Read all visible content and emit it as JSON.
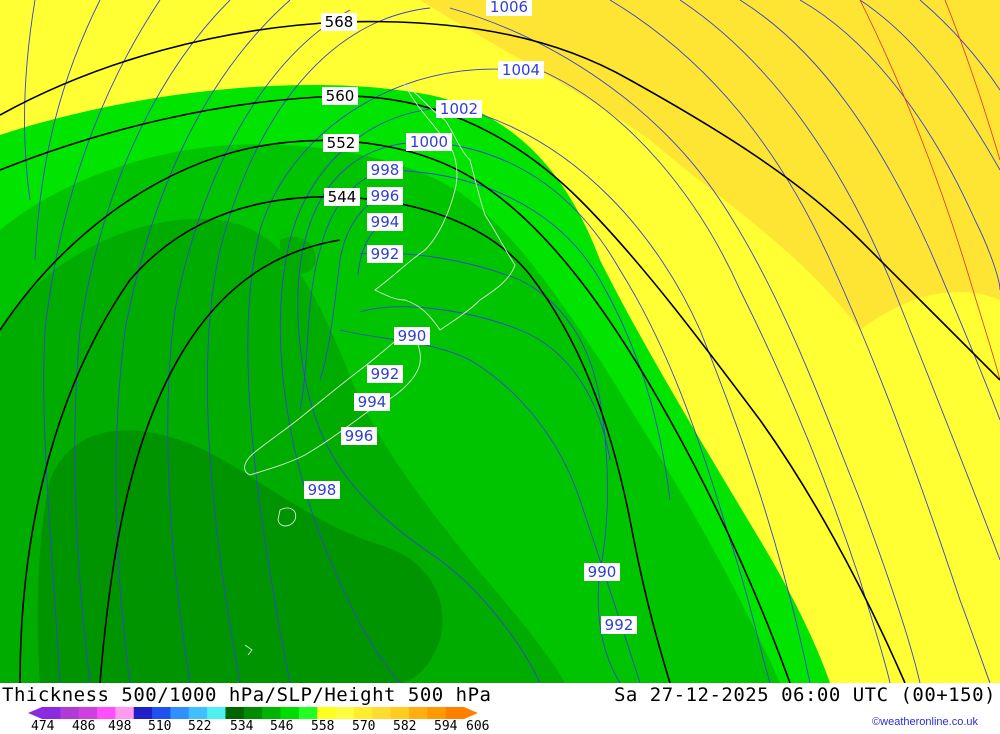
{
  "footer": {
    "title": "Thickness 500/1000 hPa/SLP/Height 500 hPa",
    "datetime": "Sa 27-12-2025 06:00 UTC (00+150)",
    "credit": "©weatheronline.co.uk"
  },
  "legend": {
    "labels": [
      "474",
      "486",
      "498",
      "510",
      "522",
      "534",
      "546",
      "558",
      "570",
      "582",
      "594",
      "606"
    ],
    "colors": [
      "#8a2be2",
      "#b03ad8",
      "#d040e0",
      "#ff4dff",
      "#ff9af0",
      "#2020c8",
      "#2050f0",
      "#3090ff",
      "#40c0ff",
      "#50f0f0",
      "#006400",
      "#008c00",
      "#00b400",
      "#00dc00",
      "#22ff22",
      "#ffff20",
      "#ffff40",
      "#ffee30",
      "#ffdd30",
      "#ffcc20",
      "#ffb010",
      "#ff9a00",
      "#ff8000"
    ]
  },
  "slp_labels": [
    "1006",
    "1004",
    "1002",
    "1000",
    "998",
    "996",
    "994",
    "992",
    "990",
    "992",
    "994",
    "996",
    "998",
    "990",
    "992"
  ],
  "height_labels": [
    "568",
    "560",
    "552",
    "544"
  ],
  "colors": {
    "yellow_light": "#ffff33",
    "yellow_dark": "#ffe533",
    "green_bright": "#00e400",
    "green_mid": "#00c000",
    "green_dark": "#00a800",
    "green_darker": "#009000",
    "slp_line": "#3545d0",
    "height_line": "#000000"
  }
}
